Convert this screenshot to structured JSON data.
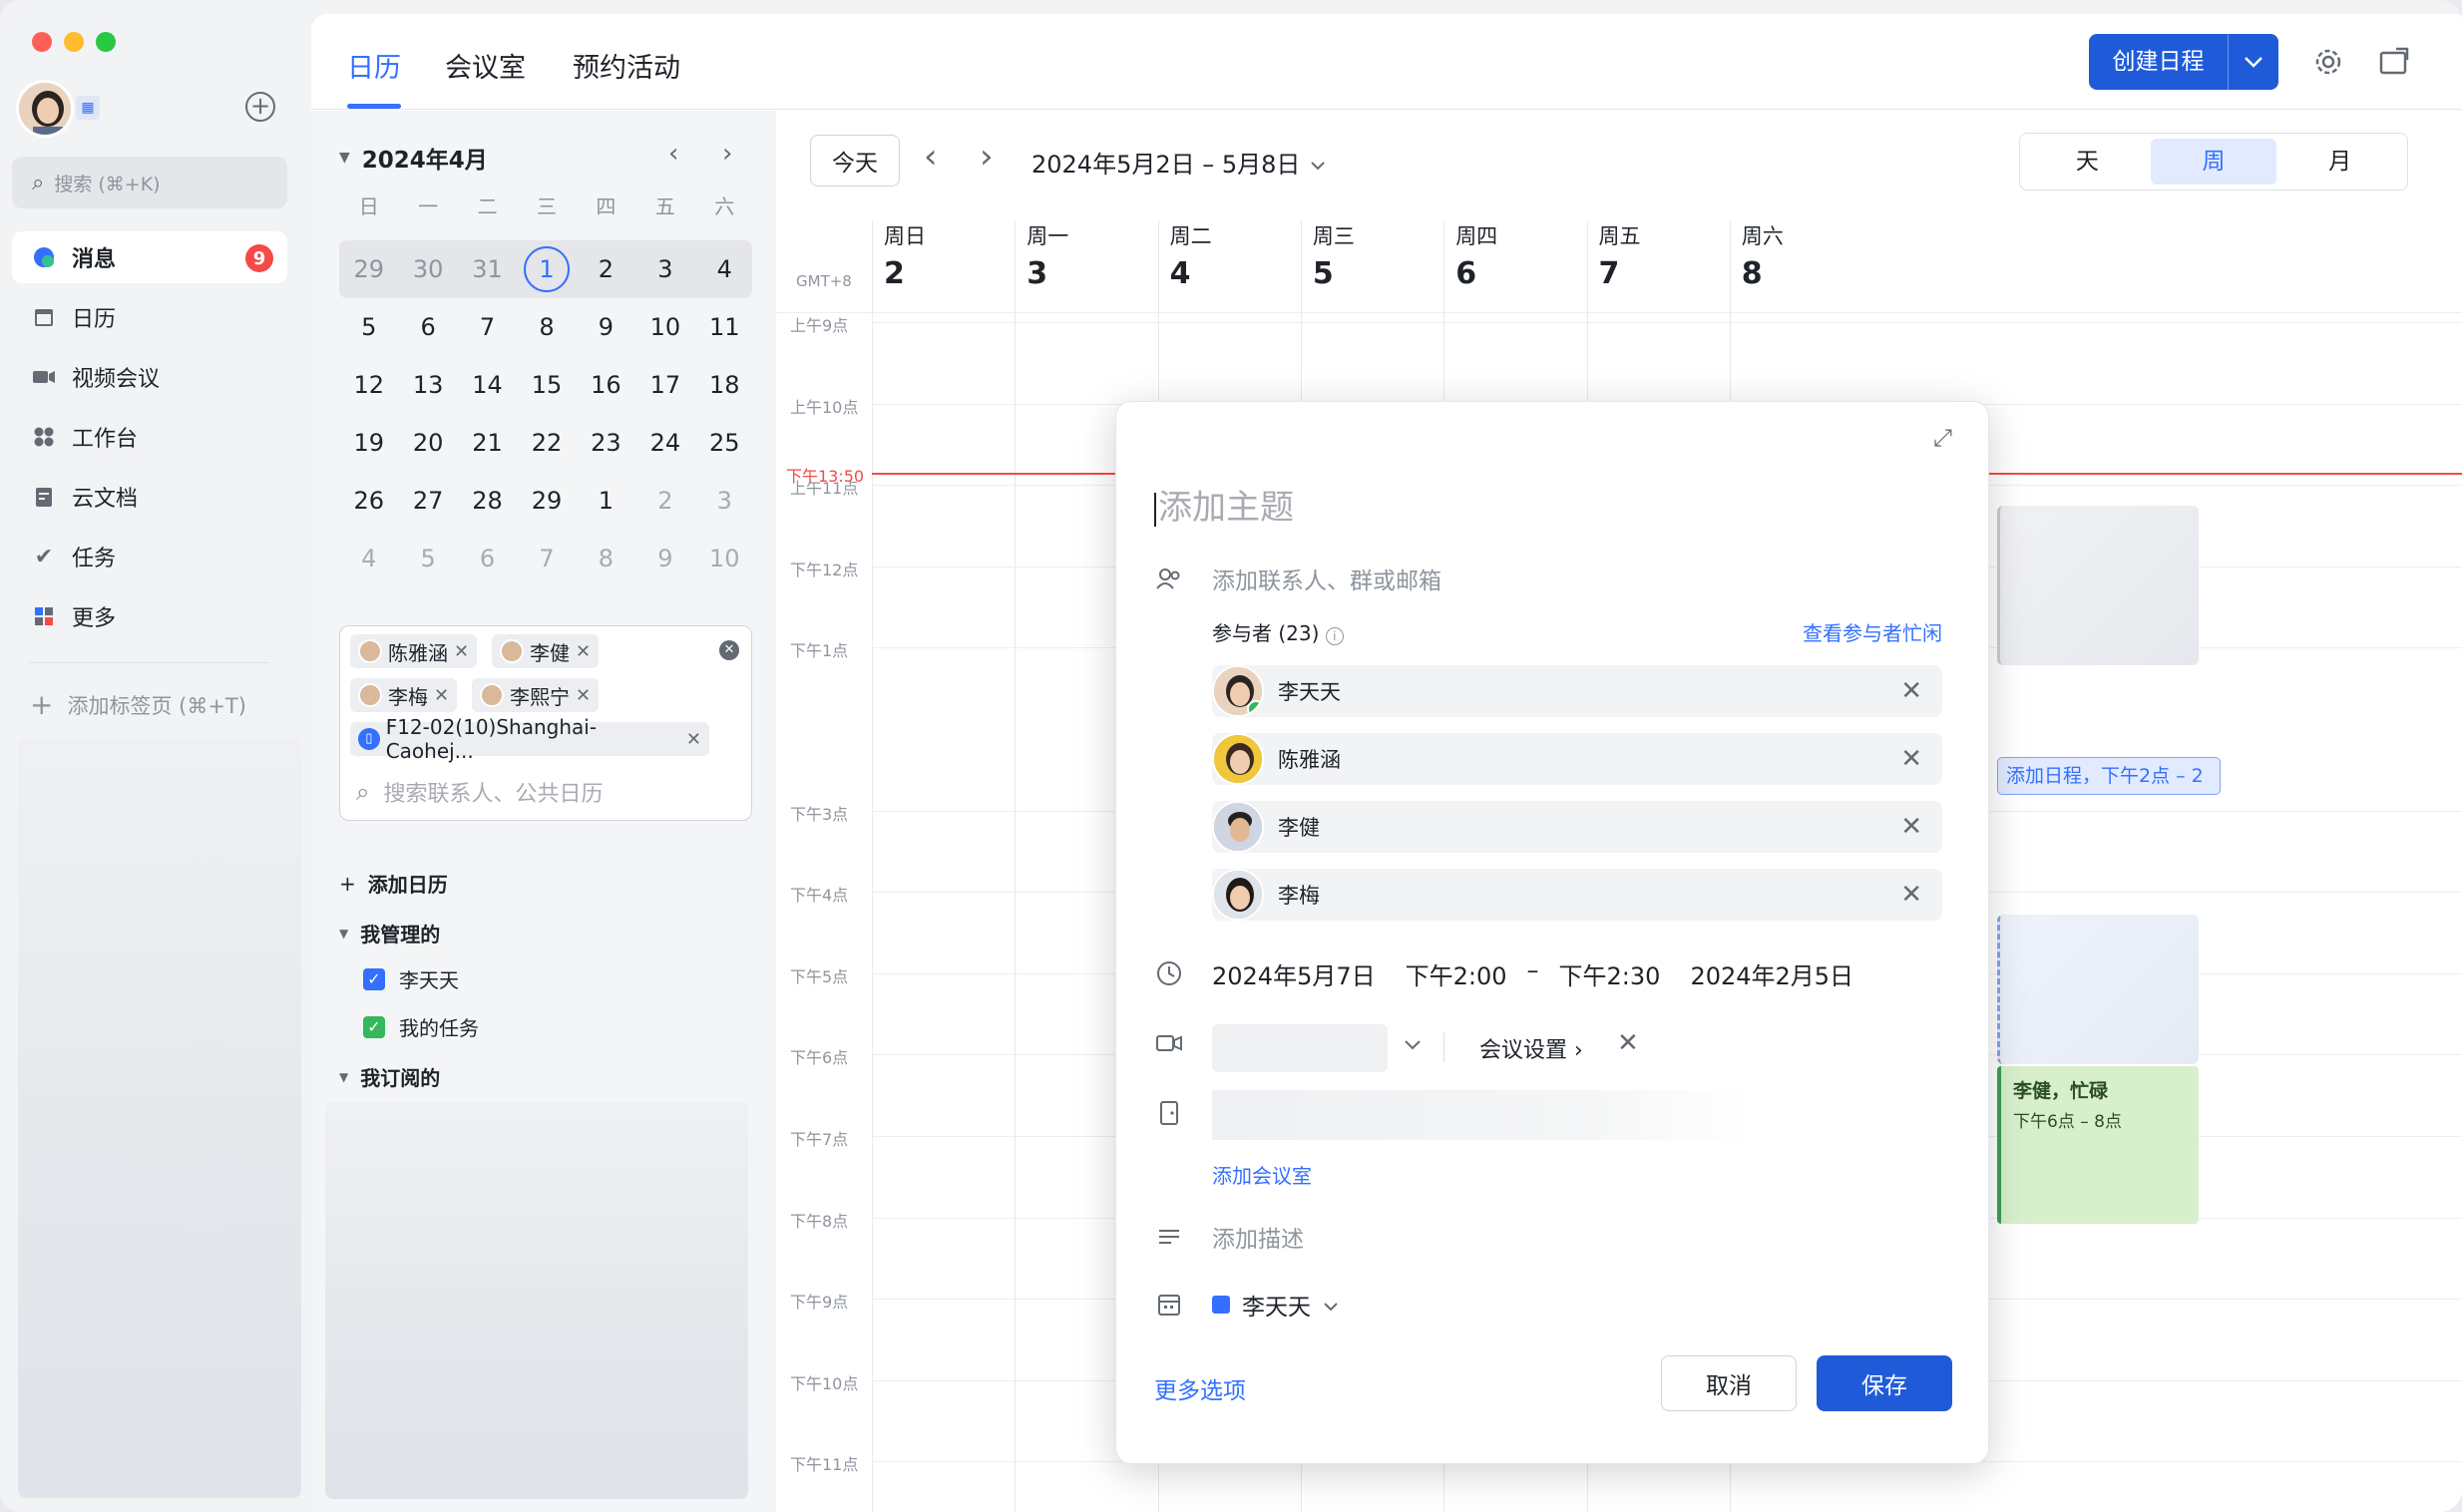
{
  "rail": {
    "search_placeholder": "搜索 (⌘+K)",
    "nav": [
      {
        "label": "消息",
        "badge": "9"
      },
      {
        "label": "日历"
      },
      {
        "label": "视频会议"
      },
      {
        "label": "工作台"
      },
      {
        "label": "云文档"
      },
      {
        "label": "任务"
      },
      {
        "label": "更多"
      }
    ],
    "add_tab": "添加标签页 (⌘+T)"
  },
  "topbar": {
    "tabs": [
      "日历",
      "会议室",
      "预约活动"
    ],
    "create_label": "创建日程"
  },
  "mini_calendar": {
    "title": "2024年4月",
    "weekdays": [
      "日",
      "一",
      "二",
      "三",
      "四",
      "五",
      "六"
    ],
    "weeks": [
      [
        "29",
        "30",
        "31",
        "1",
        "2",
        "3",
        "4"
      ],
      [
        "5",
        "6",
        "7",
        "8",
        "9",
        "10",
        "11"
      ],
      [
        "12",
        "13",
        "14",
        "15",
        "16",
        "17",
        "18"
      ],
      [
        "19",
        "20",
        "21",
        "22",
        "23",
        "24",
        "25"
      ],
      [
        "26",
        "27",
        "28",
        "29",
        "1",
        "2",
        "3"
      ],
      [
        "4",
        "5",
        "6",
        "7",
        "8",
        "9",
        "10"
      ]
    ]
  },
  "picker": {
    "chips": [
      "陈雅涵",
      "李健",
      "李梅",
      "李熙宁",
      "F12-02(10)Shanghai-Caohej..."
    ],
    "search_placeholder": "搜索联系人、公共日历"
  },
  "calendars": {
    "add": "添加日历",
    "managed": "我管理的",
    "managed_items": [
      "李天天",
      "我的任务"
    ],
    "subscribed": "我订阅的"
  },
  "week": {
    "today": "今天",
    "range": "2024年5月2日 – 5月8日",
    "views": [
      "天",
      "周",
      "月"
    ],
    "gmt": "GMT+8",
    "days": [
      {
        "name": "周日",
        "num": "2"
      },
      {
        "name": "周一",
        "num": "3"
      },
      {
        "name": "周二",
        "num": "4"
      },
      {
        "name": "周三",
        "num": "5"
      },
      {
        "name": "周四",
        "num": "6"
      },
      {
        "name": "周五",
        "num": "7"
      },
      {
        "name": "周六",
        "num": "8"
      }
    ],
    "hours": [
      "上午9点",
      "上午10点",
      "上午11点",
      "下午12点",
      "下午1点",
      "下午13:50",
      "下午3点",
      "下午4点",
      "下午5点",
      "下午6点",
      "下午7点",
      "下午8点",
      "下午9点",
      "下午10点",
      "下午11点"
    ],
    "now_label": "下午13:50",
    "add_event": "添加日程，下午2点 – 2",
    "busy_title": "李健，忙碌",
    "busy_time": "下午6点 – 8点"
  },
  "modal": {
    "subject_placeholder": "添加主题",
    "invite_placeholder": "添加联系人、群或邮箱",
    "attendees_header": "参与者 (23)",
    "attendees_link": "查看参与者忙闲",
    "attendees": [
      "李天天",
      "陈雅涵",
      "李健",
      "李梅"
    ],
    "date": "2024年5月7日",
    "start": "下午2:00",
    "dash": "–",
    "end": "下午2:30",
    "end_date": "2024年2月5日",
    "meeting_settings": "会议设置 ›",
    "add_room": "添加会议室",
    "desc_placeholder": "添加描述",
    "calendar_owner": "李天天",
    "more_options": "更多选项",
    "cancel": "取消",
    "save": "保存"
  }
}
